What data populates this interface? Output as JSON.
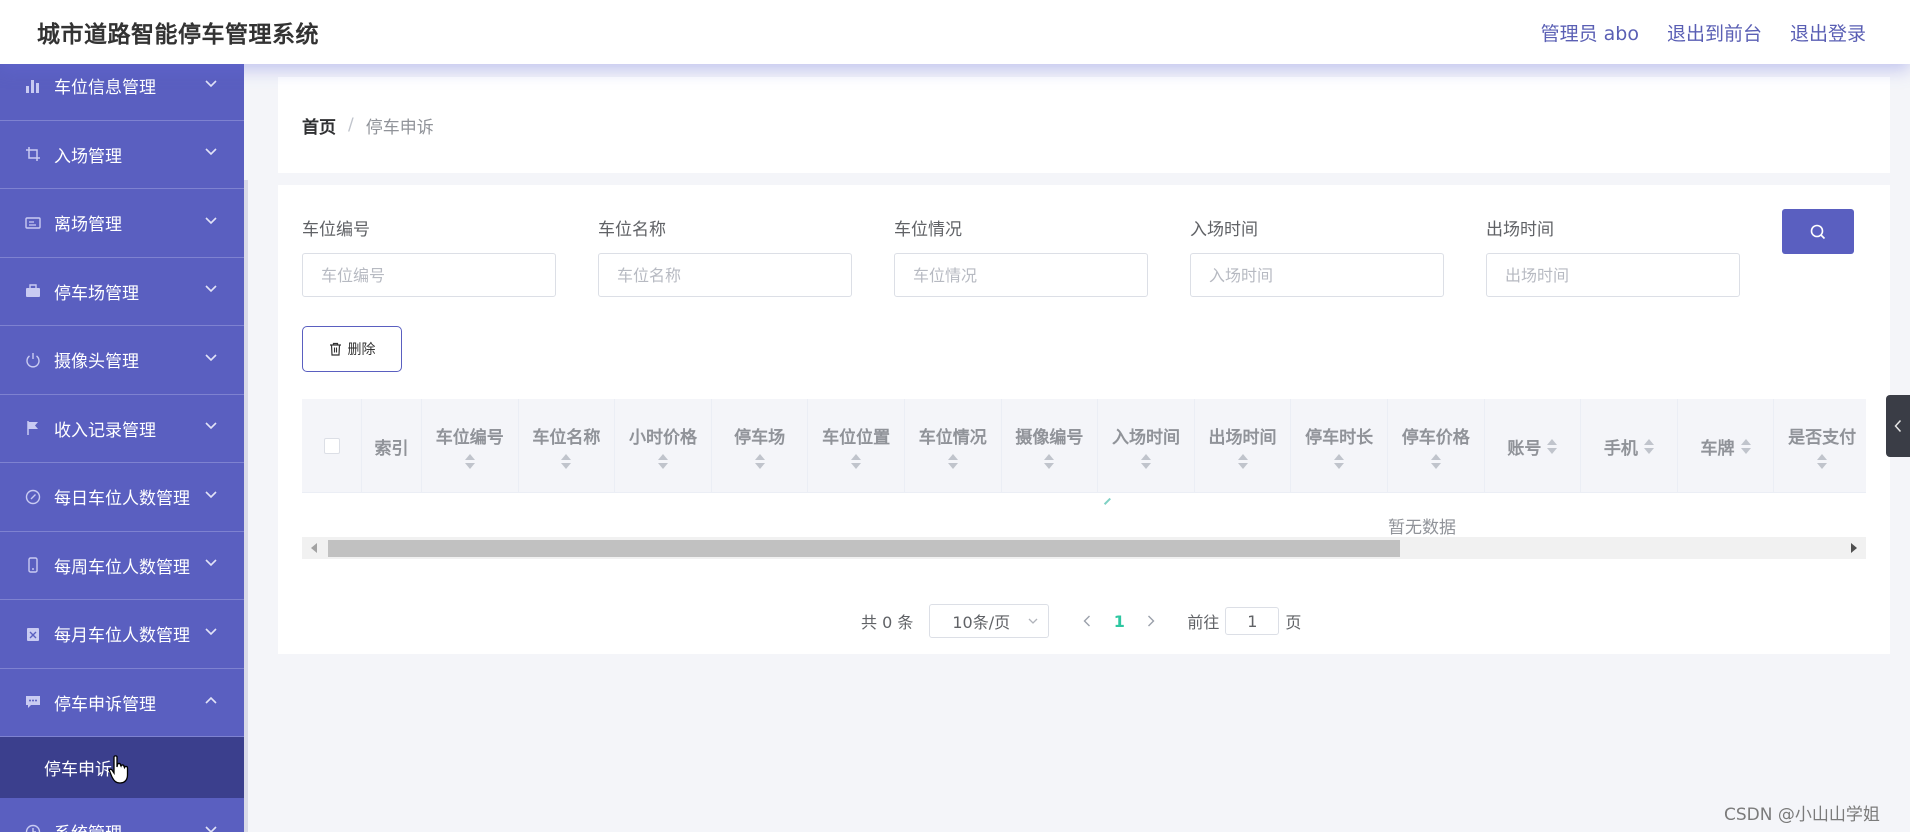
{
  "header": {
    "title": "城市道路智能停车管理系统",
    "admin": "管理员 abo",
    "to_front": "退出到前台",
    "logout": "退出登录"
  },
  "sidebar": {
    "items": [
      {
        "label": "车位信息管理",
        "icon": "bar-chart-icon"
      },
      {
        "label": "入场管理",
        "icon": "crop-icon"
      },
      {
        "label": "离场管理",
        "icon": "id-card-icon"
      },
      {
        "label": "停车场管理",
        "icon": "briefcase-icon"
      },
      {
        "label": "摄像头管理",
        "icon": "power-icon"
      },
      {
        "label": "收入记录管理",
        "icon": "flag-icon"
      },
      {
        "label": "每日车位人数管理",
        "icon": "compass-icon"
      },
      {
        "label": "每周车位人数管理",
        "icon": "phone-icon"
      },
      {
        "label": "每月车位人数管理",
        "icon": "clipboard-icon"
      },
      {
        "label": "停车申诉管理",
        "icon": "message-icon"
      },
      {
        "label": "系统管理",
        "icon": "clock-icon"
      }
    ],
    "sub_item": "停车申诉"
  },
  "breadcrumb": {
    "home": "首页",
    "separator": "/",
    "current": "停车申诉"
  },
  "search": {
    "fields": [
      {
        "label": "车位编号",
        "placeholder": "车位编号"
      },
      {
        "label": "车位名称",
        "placeholder": "车位名称"
      },
      {
        "label": "车位情况",
        "placeholder": "车位情况"
      },
      {
        "label": "入场时间",
        "placeholder": "入场时间"
      },
      {
        "label": "出场时间",
        "placeholder": "出场时间"
      }
    ]
  },
  "toolbar": {
    "delete_label": "删除"
  },
  "table": {
    "index_header": "索引",
    "columns": [
      "车位编号",
      "车位名称",
      "小时价格",
      "停车场",
      "车位位置",
      "车位情况",
      "摄像编号",
      "入场时间",
      "出场时间",
      "停车时长",
      "停车价格",
      "账号",
      "手机",
      "车牌",
      "是否支付"
    ],
    "empty_text": "暂无数据"
  },
  "pagination": {
    "total": "共 0 条",
    "page_size": "10条/页",
    "current_page": "1",
    "goto_label": "前往",
    "goto_value": "1",
    "page_suffix": "页"
  },
  "watermark": "CSDN @小山山学姐",
  "colors": {
    "primary": "#5a5fc0",
    "sidebar_active": "#3b3f8d",
    "page_accent": "#2ec7a1"
  }
}
